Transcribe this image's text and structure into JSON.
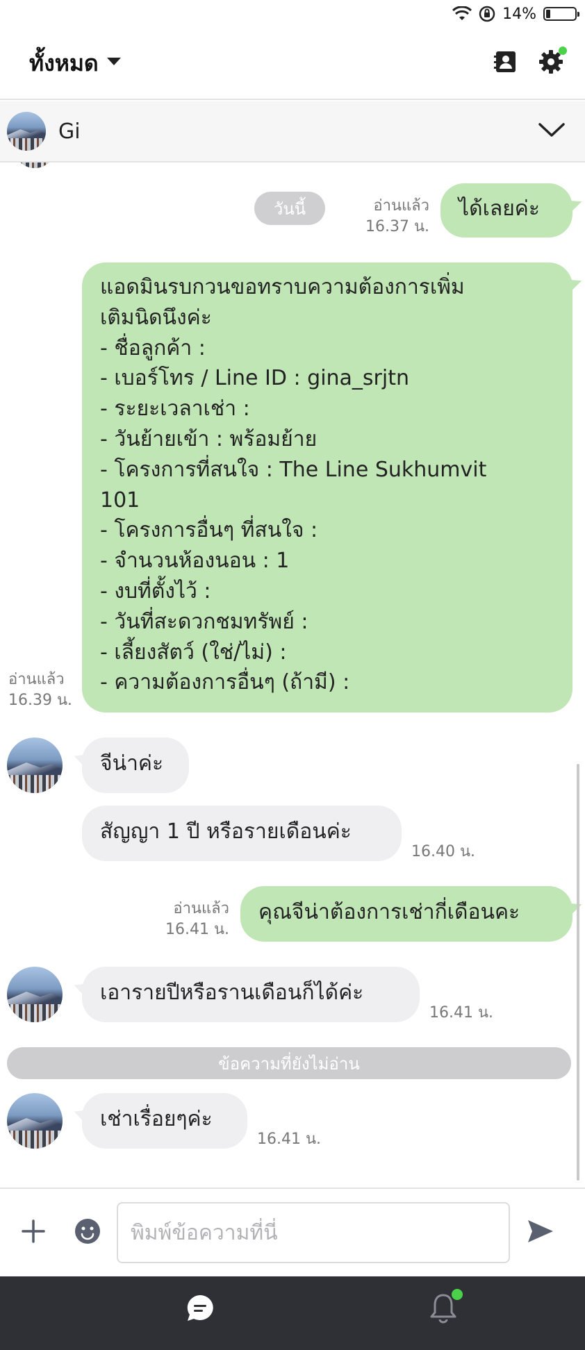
{
  "status_bar": {
    "battery": "14%",
    "battery_level": 0.14
  },
  "header": {
    "title": "ทั้งหมด"
  },
  "chat": {
    "name": "Gi"
  },
  "date_pill": "วันนี้",
  "messages": {
    "m1": {
      "text": "ได้เลยค่ะ",
      "read": "อ่านแล้ว",
      "time": "16.37 น."
    },
    "m2": {
      "lines": [
        "แอดมินรบกวนขอทราบความต้องการเพิ่ม",
        "เติมนิดนึงค่ะ",
        "- ชื่อลูกค้า :",
        "- เบอร์โทร / Line ID : gina_srjtn",
        "- ระยะเวลาเช่า :",
        "- วันย้ายเข้า : พร้อมย้าย",
        "- โครงการที่สนใจ : The Line Sukhumvit",
        "101",
        "- โครงการอื่นๆ ที่สนใจ :",
        "- จำนวนห้องนอน : 1",
        "- งบที่ตั้งไว้ :",
        "- วันที่สะดวกชมทรัพย์ :",
        "- เลี้ยงสัตว์ (ใช่/ไม่) :",
        "- ความต้องการอื่นๆ (ถ้ามี) :"
      ],
      "read": "อ่านแล้ว",
      "time": "16.39 น."
    },
    "m3": {
      "text": "จีน่าค่ะ"
    },
    "m4": {
      "text": "สัญญา 1 ปี หรือรายเดือนค่ะ",
      "time": "16.40 น."
    },
    "m5": {
      "text": "คุณจีน่าต้องการเช่ากี่เดือนคะ",
      "read": "อ่านแล้ว",
      "time": "16.41 น."
    },
    "m6": {
      "text": "เอารายปีหรือรานเดือนก็ได้ค่ะ",
      "time": "16.41 น."
    },
    "m7": {
      "text": "เช่าเรื่อยๆค่ะ",
      "time": "16.41 น."
    }
  },
  "unread_divider": "ข้อความที่ยังไม่อ่าน",
  "composer": {
    "placeholder": "พิมพ์ข้อความที่นี่"
  },
  "colors": {
    "outgoing_bubble": "#c1e6b6",
    "incoming_bubble": "#efeff2",
    "badge": "#4cd14a",
    "nav_bg": "#2e3035"
  },
  "icons": [
    "wifi-icon",
    "orientation-lock-icon",
    "battery-icon",
    "contacts-icon",
    "gear-icon",
    "chevron-down-icon",
    "plus-icon",
    "emoji-icon",
    "send-icon",
    "chat-icon",
    "bell-icon"
  ]
}
